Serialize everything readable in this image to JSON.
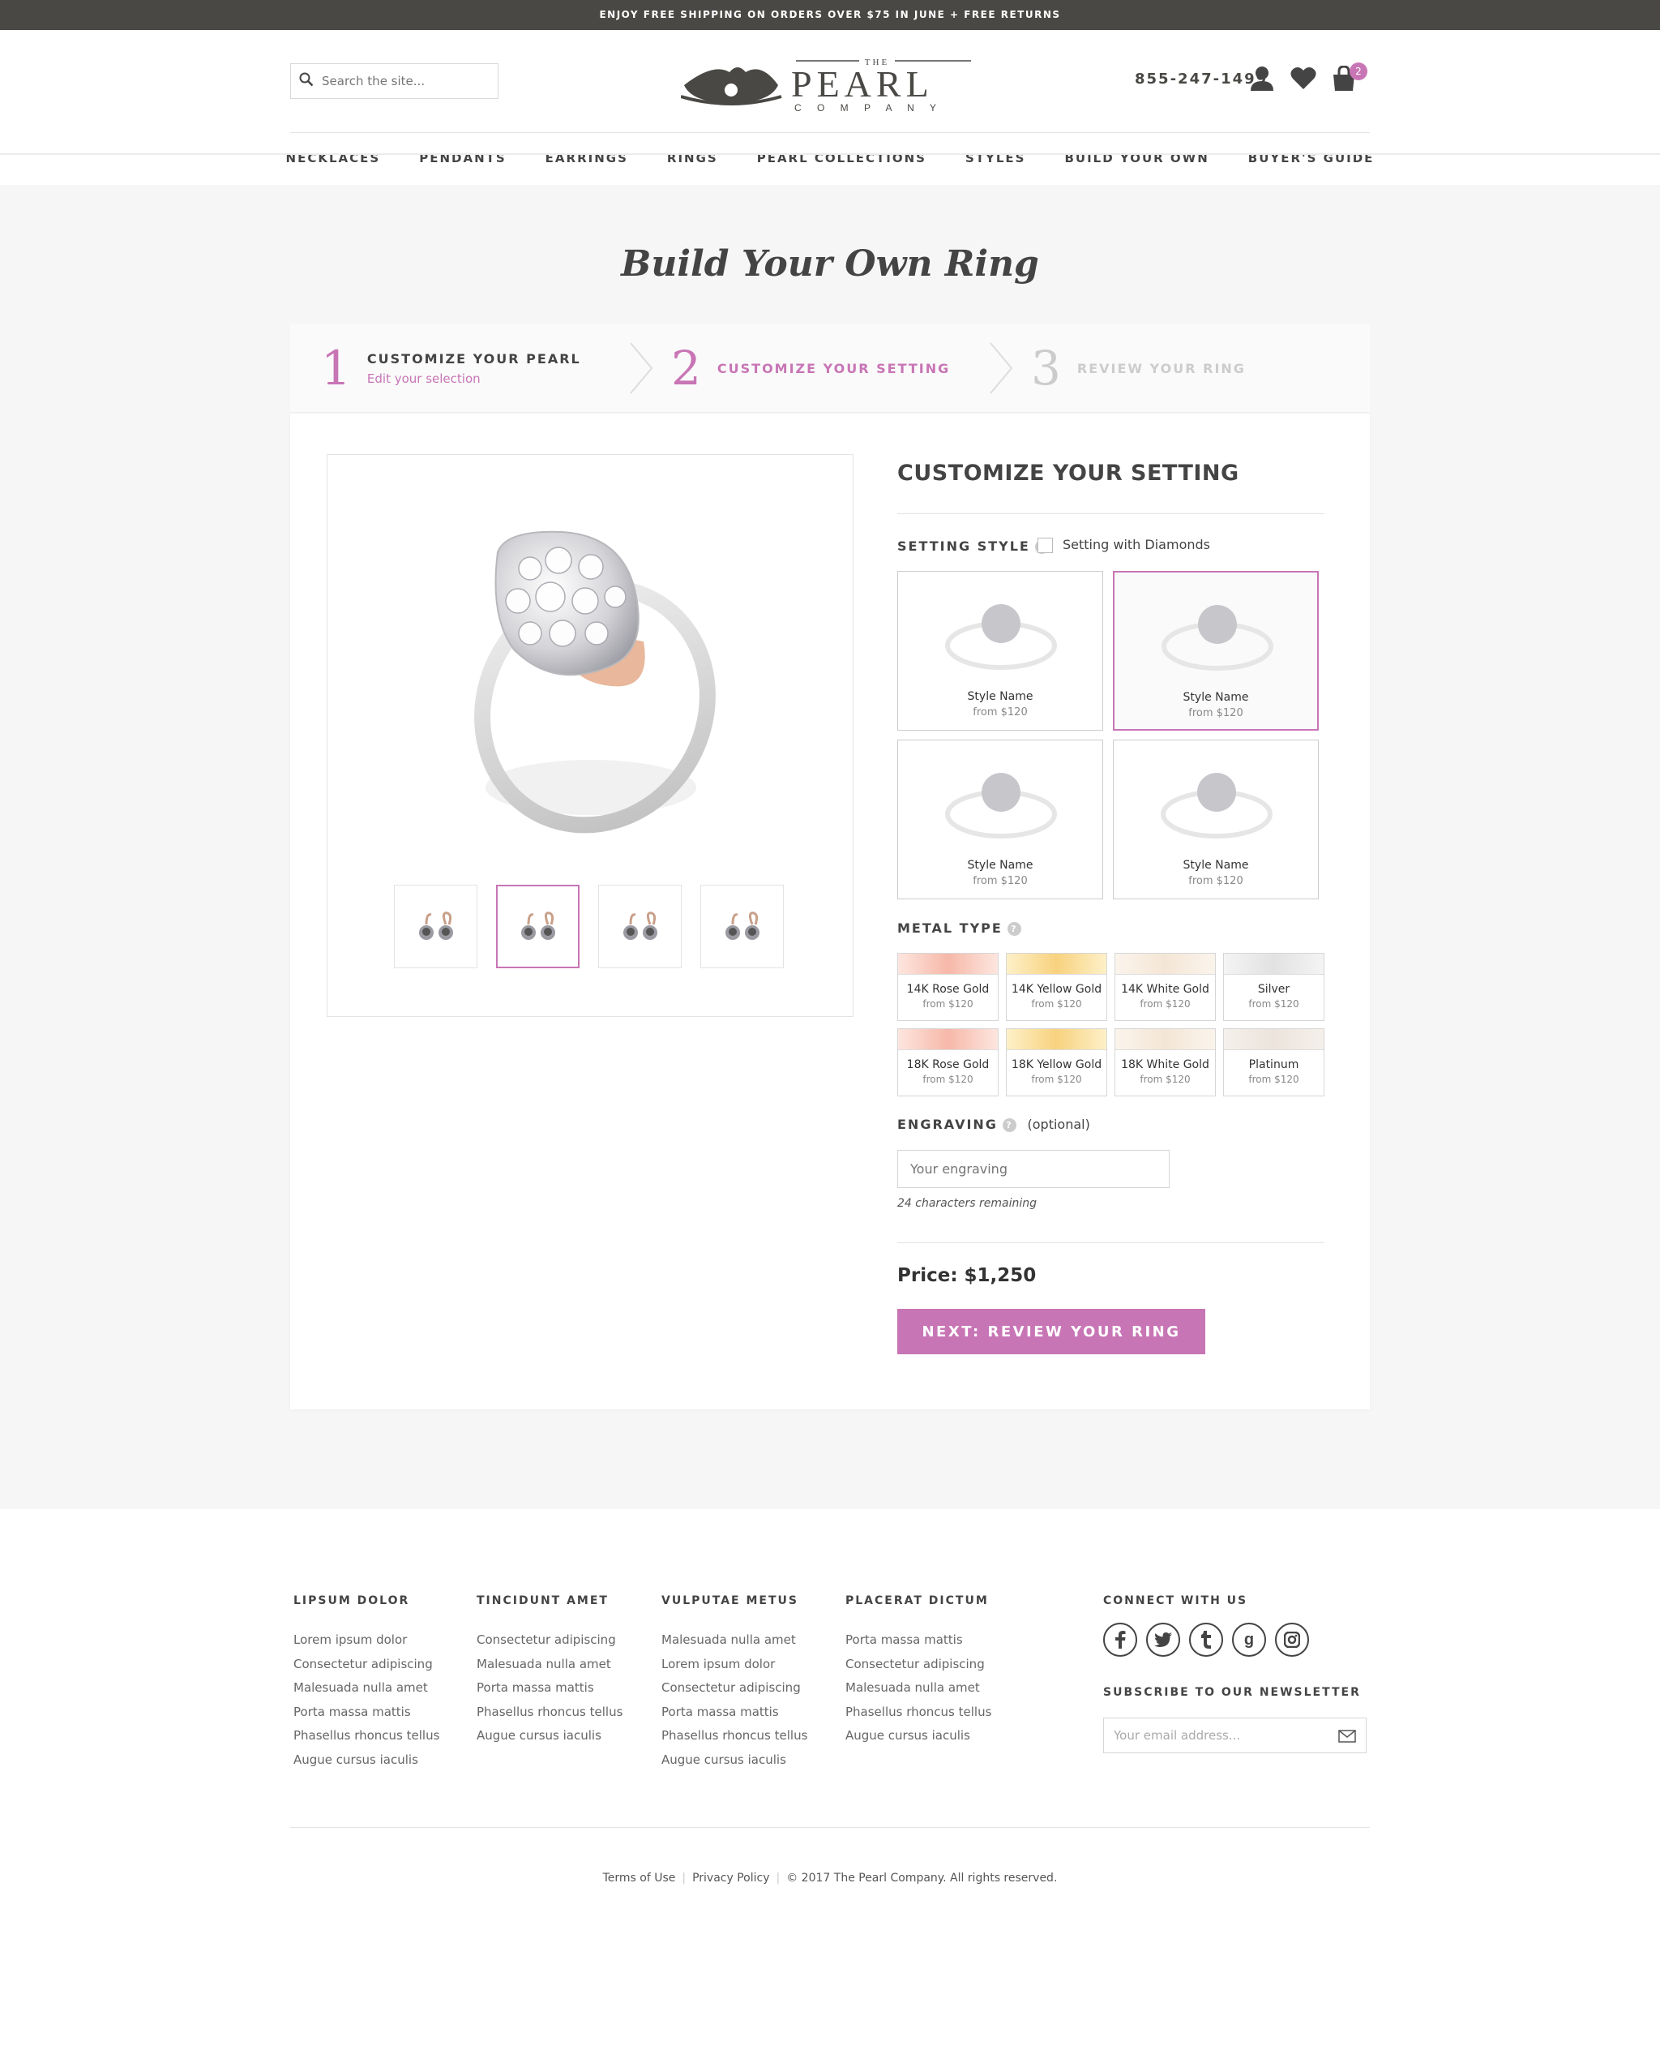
{
  "promo_bar": {
    "text": "ENJOY FREE SHIPPING ON ORDERS OVER $75 IN JUNE + FREE RETURNS"
  },
  "header": {
    "search_placeholder": "Search the site...",
    "logo": {
      "the": "THE",
      "pearl": "PEARL",
      "company": "C O M P A N Y"
    },
    "phone": "855-247-1499",
    "cart_count": "2",
    "icons": [
      "search-icon",
      "account-icon",
      "heart-icon",
      "cart-icon"
    ]
  },
  "nav": {
    "items": [
      {
        "label": "NECKLACES"
      },
      {
        "label": "PENDANTS"
      },
      {
        "label": "EARRINGS"
      },
      {
        "label": "RINGS"
      },
      {
        "label": "PEARL COLLECTIONS"
      },
      {
        "label": "STYLES"
      },
      {
        "label": "BUILD YOUR OWN"
      },
      {
        "label": "BUYER'S GUIDE"
      }
    ]
  },
  "page": {
    "title": "Build Your Own Ring"
  },
  "steps": [
    {
      "number": "1",
      "label": "CUSTOMIZE YOUR PEARL",
      "sublink": "Edit your selection",
      "state": "done"
    },
    {
      "number": "2",
      "label": "CUSTOMIZE YOUR SETTING",
      "state": "active"
    },
    {
      "number": "3",
      "label": "REVIEW YOUR RING",
      "state": "upcoming"
    }
  ],
  "customizer": {
    "heading": "CUSTOMIZE YOUR SETTING",
    "setting_style": {
      "label": "SETTING STYLE",
      "help": "?",
      "diamonds_checkbox_label": "Setting with Diamonds",
      "diamonds_checked": false,
      "styles": [
        {
          "name": "Style Name",
          "price": "from $120",
          "selected": false
        },
        {
          "name": "Style Name",
          "price": "from $120",
          "selected": true
        },
        {
          "name": "Style Name",
          "price": "from $120",
          "selected": false
        },
        {
          "name": "Style Name",
          "price": "from $120",
          "selected": false
        }
      ]
    },
    "metal_type": {
      "label": "METAL TYPE",
      "help": "?",
      "options": [
        {
          "name": "14K Rose Gold",
          "price": "from $120",
          "color": "#f6b8a8"
        },
        {
          "name": "14K Yellow Gold",
          "price": "from $120",
          "color": "#f8d27f"
        },
        {
          "name": "14K White Gold",
          "price": "from $120",
          "color": "#f4e6d6"
        },
        {
          "name": "Silver",
          "price": "from $120",
          "color": "#e2e2e2"
        },
        {
          "name": "18K Rose Gold",
          "price": "from $120",
          "color": "#f6b8a8"
        },
        {
          "name": "18K Yellow Gold",
          "price": "from $120",
          "color": "#f8d27f"
        },
        {
          "name": "18K White Gold",
          "price": "from $120",
          "color": "#f4e6d6"
        },
        {
          "name": "Platinum",
          "price": "from $120",
          "color": "#ece4dc"
        }
      ]
    },
    "engraving": {
      "label": "ENGRAVING",
      "help": "?",
      "optional": "(optional)",
      "placeholder": "Your engraving",
      "remaining": "24 characters remaining"
    },
    "price": "Price: $1,250",
    "next_button": "NEXT: REVIEW YOUR RING"
  },
  "footer": {
    "columns": [
      {
        "heading": "LIPSUM DOLOR",
        "links": [
          "Lorem ipsum dolor",
          "Consectetur adipiscing",
          "Malesuada nulla amet",
          "Porta massa mattis",
          "Phasellus rhoncus tellus",
          "Augue cursus iaculis"
        ]
      },
      {
        "heading": "TINCIDUNT AMET",
        "links": [
          "Consectetur adipiscing",
          "Malesuada nulla amet",
          "Porta massa mattis",
          "Phasellus rhoncus tellus",
          "Augue cursus iaculis"
        ]
      },
      {
        "heading": "VULPUTAE METUS",
        "links": [
          "Malesuada nulla amet",
          "Lorem ipsum dolor",
          "Consectetur adipiscing",
          "Porta massa mattis",
          "Phasellus rhoncus tellus",
          "Augue cursus iaculis"
        ]
      },
      {
        "heading": "PLACERAT DICTUM",
        "links": [
          "Porta massa mattis",
          "Consectetur adipiscing",
          "Malesuada nulla amet",
          "Phasellus rhoncus tellus",
          "Augue cursus iaculis"
        ]
      }
    ],
    "connect_heading": "CONNECT WITH US",
    "social": [
      "facebook-icon",
      "twitter-icon",
      "tumblr-icon",
      "google-icon",
      "instagram-icon"
    ],
    "newsletter_heading": "SUBSCRIBE TO OUR NEWSLETTER",
    "email_placeholder": "Your email address...",
    "legal": {
      "terms": "Terms of Use",
      "privacy": "Privacy Policy",
      "copyright": "© 2017 The Pearl Company. All rights reserved."
    }
  },
  "colors": {
    "accent": "#c875b5",
    "topbar": "#4a4845",
    "background": "#f6f6f6"
  }
}
